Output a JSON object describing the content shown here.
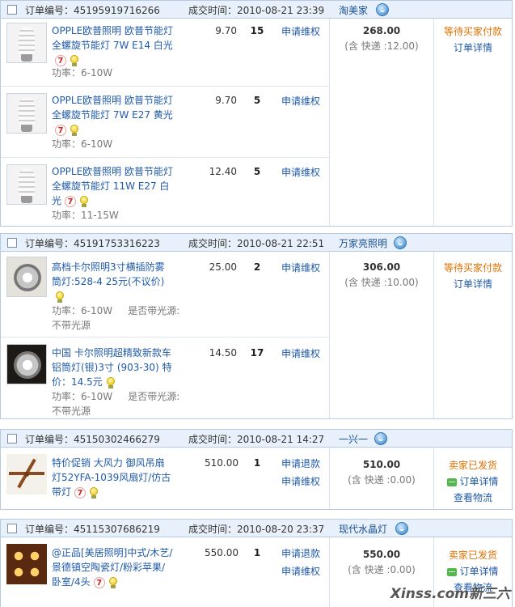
{
  "labels": {
    "order_no": "订单编号：",
    "deal_time": "成交时间："
  },
  "orders": [
    {
      "order_no": "45195919716266",
      "time": "2010-08-21 23:39",
      "seller": "淘美家",
      "total": "268.00",
      "shipping": "(含 快递 :12.00)",
      "status": "等待买家付款",
      "links": [
        "订单详情"
      ],
      "items": [
        {
          "title": "OPPLE欧普照明 欧普节能灯 全螺旋节能灯 7W E14 白光",
          "spec": "功率：6-10W",
          "spec2": "",
          "price": "9.70",
          "qty": "15",
          "actions": [
            "申请维权"
          ],
          "badges": [
            "7",
            "bulb"
          ]
        },
        {
          "title": "OPPLE欧普照明 欧普节能灯 全螺旋节能灯 7W E27 黄光",
          "spec": "功率：6-10W",
          "spec2": "",
          "price": "9.70",
          "qty": "5",
          "actions": [
            "申请维权"
          ],
          "badges": [
            "7",
            "bulb"
          ]
        },
        {
          "title": "OPPLE欧普照明 欧普节能灯 全螺旋节能灯 11W E27 白光",
          "spec": "功率：11-15W",
          "spec2": "",
          "price": "12.40",
          "qty": "5",
          "actions": [
            "申请维权"
          ],
          "badges": [
            "7",
            "bulb"
          ]
        }
      ]
    },
    {
      "order_no": "45191753316223",
      "time": "2010-08-21 22:51",
      "seller": "万家亮照明",
      "total": "306.00",
      "shipping": "(含 快递 :10.00)",
      "status": "等待买家付款",
      "links": [
        "订单详情"
      ],
      "items": [
        {
          "title": "高档卡尔照明3寸横插防雾筒灯:528-4 25元(不议价)",
          "spec": "功率：6-10W",
          "spec2": "是否带光源:",
          "spec3": "不带光源",
          "price": "25.00",
          "qty": "2",
          "actions": [
            "申请维权"
          ],
          "badges": [
            "bulb"
          ]
        },
        {
          "title": "中国 卡尔照明超精致新款车铝筒灯(银)3寸 (903-30) 特价：14.5元",
          "spec": "功率：6-10W",
          "spec2": "是否带光源:",
          "spec3": "不带光源",
          "price": "14.50",
          "qty": "17",
          "actions": [
            "申请维权"
          ],
          "badges": [
            "bulb"
          ]
        }
      ]
    },
    {
      "order_no": "45150302466279",
      "time": "2010-08-21 14:27",
      "seller": "一兴一",
      "total": "510.00",
      "shipping": "(含 快递 :0.00)",
      "status": "卖家已发货",
      "links": [
        "订单详情",
        "查看物流"
      ],
      "items": [
        {
          "title": "特价促销 大风力 御风吊扇灯52YFA-1039风扇灯/仿古带灯",
          "spec": "",
          "spec2": "",
          "price": "510.00",
          "qty": "1",
          "actions": [
            "申请退款",
            "申请维权"
          ],
          "badges": [
            "7",
            "bulb"
          ]
        }
      ]
    },
    {
      "order_no": "45115307686219",
      "time": "2010-08-20 23:37",
      "seller": "现代水晶灯",
      "total": "550.00",
      "shipping": "(含 快递 :0.00)",
      "status": "卖家已发货",
      "links": [
        "订单详情",
        "查看物流"
      ],
      "items": [
        {
          "title": "@正品[美居照明]中式/木艺/景德镇空陶瓷灯/粉彩苹果/卧室/4头",
          "spec": "",
          "spec2": "",
          "price": "550.00",
          "qty": "1",
          "actions": [
            "申请退款",
            "申请维权"
          ],
          "badges": [
            "7",
            "bulb"
          ]
        }
      ]
    }
  ],
  "watermark": "Xinss.com新三六"
}
